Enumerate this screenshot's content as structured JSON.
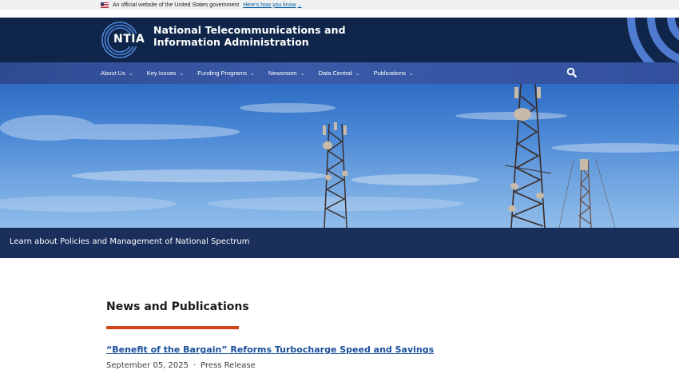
{
  "gov_banner": {
    "text": "An official website of the United States government",
    "link_label": "Here's how you know"
  },
  "header": {
    "logo_text": "NTIA",
    "title_line1": "National Telecommunications and",
    "title_line2": "Information Administration"
  },
  "nav": {
    "items": [
      {
        "label": "About Us"
      },
      {
        "label": "Key Issues"
      },
      {
        "label": "Funding Programs"
      },
      {
        "label": "Newsroom"
      },
      {
        "label": "Data Central"
      },
      {
        "label": "Publications"
      }
    ],
    "search_icon": "search-icon"
  },
  "hero": {
    "caption": "Learn about Policies and Management of National Spectrum"
  },
  "news": {
    "title": "News and Publications",
    "articles": [
      {
        "title": "“Benefit of the Bargain” Reforms Turbocharge Speed and Savings",
        "date": "September 05, 2025",
        "separator": "·",
        "type": "Press Release"
      }
    ]
  },
  "colors": {
    "header_bg": "#0f2549",
    "nav_bg": "#3a5aa8",
    "caption_bg": "#1a2f5c",
    "accent_rule": "#d1461b",
    "link": "#1a4f9c"
  }
}
